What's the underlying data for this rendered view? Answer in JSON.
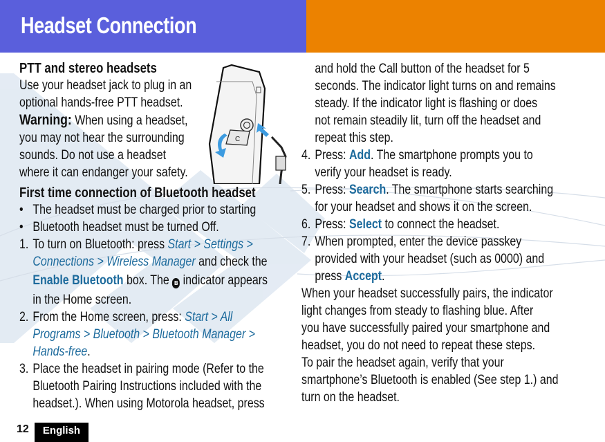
{
  "header": {
    "title": "Headset Connection",
    "colors": {
      "left": "#5a5fdc",
      "right": "#ec8200"
    }
  },
  "accent_color": "#1c6a9c",
  "section_ptt": {
    "heading": "PTT and stereo headsets",
    "lines": [
      "Use your headset jack to plug in an",
      "optional hands-free PTT headset."
    ],
    "warning_label": "Warning:",
    "warning_first": " When using a headset,",
    "warning_lines": [
      "you may not hear the surrounding",
      "sounds. Do not use a headset",
      "where it can endanger your safety."
    ],
    "illustration": "phone-headset-jack-illustration"
  },
  "section_bt": {
    "heading": "First time connection of Bluetooth headset",
    "bullets": [
      "The headset must be charged prior to starting",
      "Bluetooth headset must be turned Off."
    ],
    "step1": {
      "num": "1.",
      "pre": "To turn on Bluetooth: press ",
      "path1": "Start > Settings >",
      "path2": "Connections > Wireless Manager",
      "mid": " and check the",
      "bold": "Enable Bluetooth",
      "post1": " box. The ",
      "icon": "bluetooth-icon",
      "post2": " indicator appears",
      "last": "in the Home screen."
    },
    "step2": {
      "num": "2.",
      "pre": "From the Home screen, press: ",
      "path1": "Start > All",
      "path2": "Programs > Bluetooth > Bluetooth Manager >",
      "path3": "Hands-free",
      "end": "."
    },
    "step3": {
      "num": "3.",
      "lines": [
        "Place the headset in pairing mode (Refer to the",
        "Bluetooth Pairing Instructions included with the",
        "headset.). When using Motorola headset, press"
      ],
      "continued": [
        "and hold the Call button of the headset for 5",
        "seconds. The indicator light turns on and remains",
        "steady. If the indicator light is flashing or does",
        "not remain steadily lit, turn off the headset and",
        "repeat this step."
      ]
    },
    "step4": {
      "num": "4.",
      "pre": "Press: ",
      "bold": "Add",
      "post": ". The smartphone prompts you to",
      "line2": "verify your headset is ready."
    },
    "step5": {
      "num": "5.",
      "pre": "Press: ",
      "bold": "Search",
      "post": ". The smartphone starts searching",
      "line2": "for your headset and shows it on the screen."
    },
    "step6": {
      "num": "6.",
      "pre": "Press: ",
      "bold": "Select",
      "post": " to connect the headset."
    },
    "step7": {
      "num": "7.",
      "line1": "When prompted, enter the device passkey",
      "line2": "provided with your headset (such as 0000) and",
      "pre3": "press ",
      "bold": "Accept",
      "post3": "."
    },
    "after": [
      "When your headset successfully pairs, the indicator",
      "light changes from steady to flashing blue. After",
      "you have successfully paired your smartphone and",
      "headset, you do not need to repeat these steps.",
      "To pair the headset again, verify that your",
      "smartphone’s Bluetooth is enabled (See step 1.) and",
      "turn on the headset."
    ]
  },
  "footer": {
    "page_number": "12",
    "language": "English"
  }
}
